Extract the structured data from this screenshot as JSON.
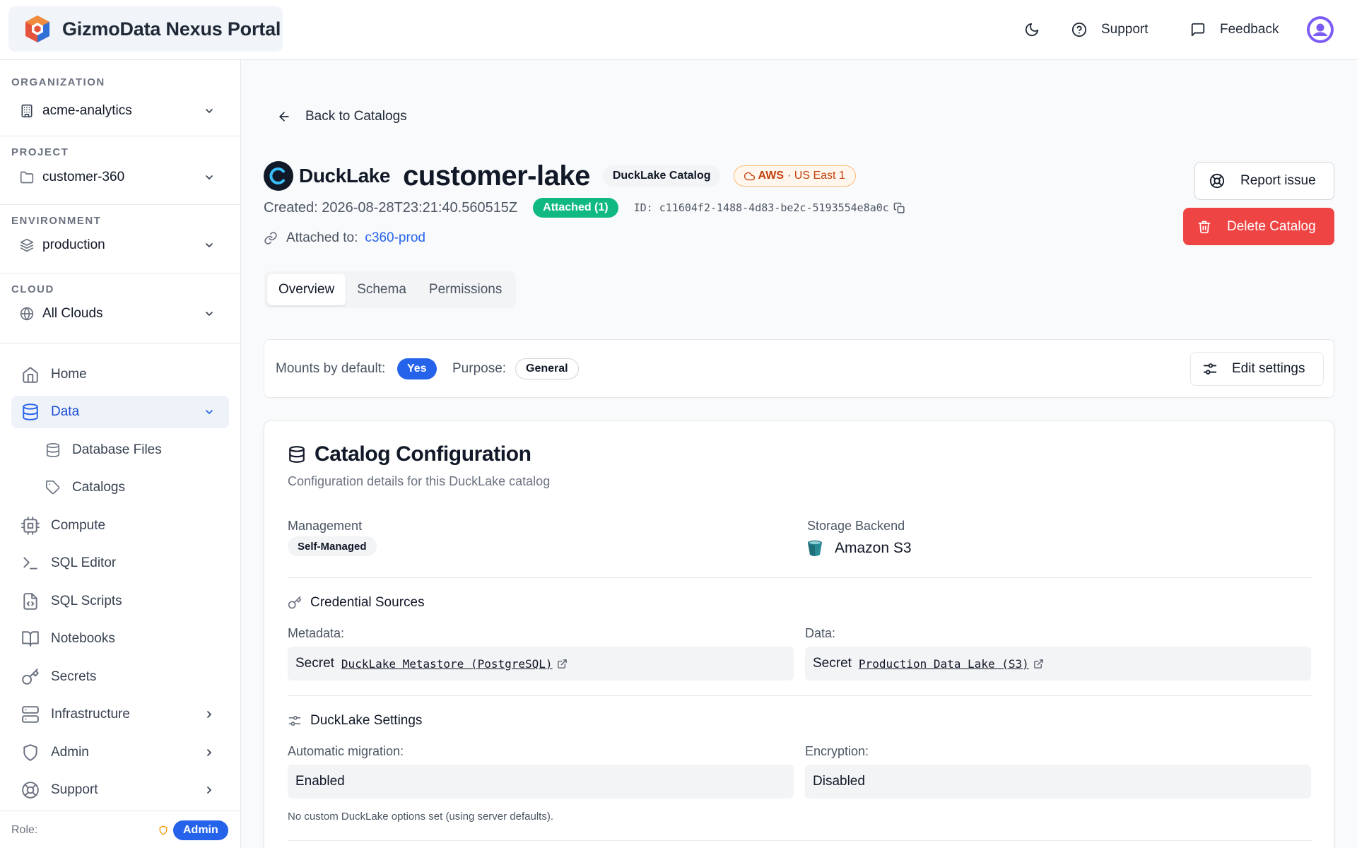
{
  "header": {
    "app_title": "GizmoData Nexus Portal",
    "support_label": "Support",
    "feedback_label": "Feedback",
    "theme_icon": "moon-icon",
    "brand_colors": {
      "accent": "#2563eb",
      "danger": "#ef4444",
      "success": "#10b981"
    }
  },
  "sidebar": {
    "organization": {
      "label": "ORGANIZATION",
      "value": "acme-analytics"
    },
    "project": {
      "label": "PROJECT",
      "value": "customer-360"
    },
    "environment": {
      "label": "ENVIRONMENT",
      "value": "production"
    },
    "cloud": {
      "label": "CLOUD",
      "value": "All Clouds"
    },
    "nav": {
      "home": "Home",
      "data": "Data",
      "database_files": "Database Files",
      "catalogs": "Catalogs",
      "compute": "Compute",
      "sql_editor": "SQL Editor",
      "sql_scripts": "SQL Scripts",
      "notebooks": "Notebooks",
      "secrets": "Secrets",
      "infrastructure": "Infrastructure",
      "admin": "Admin",
      "support": "Support"
    },
    "role": {
      "label": "Role:",
      "value": "Admin"
    }
  },
  "main": {
    "back_label": "Back to Catalogs",
    "brand_word": "DuckLake",
    "catalog_name": "customer-lake",
    "type_badge": "DuckLake Catalog",
    "cloud_badge": {
      "provider": "AWS",
      "region": "· US East 1"
    },
    "created": "Created: 2026-08-28T23:21:40.560515Z",
    "attached_badge": "Attached (1)",
    "catalog_id": "ID: c11604f2-1488-4d83-be2c-5193554e8a0c",
    "attached_to_label": "Attached to:",
    "attached_to_value": "c360-prod",
    "report_label": "Report issue",
    "delete_label": "Delete Catalog",
    "tabs": [
      {
        "label": "Overview"
      },
      {
        "label": "Schema"
      },
      {
        "label": "Permissions"
      }
    ],
    "settings_bar": {
      "mounts_label": "Mounts by default:",
      "mounts_value": "Yes",
      "purpose_label": "Purpose:",
      "purpose_value": "General",
      "edit_label": "Edit settings"
    },
    "config": {
      "title": "Catalog Configuration",
      "subtitle": "Configuration details for this DuckLake catalog",
      "management_label": "Management",
      "management_value": "Self-Managed",
      "storage_label": "Storage Backend",
      "storage_value": "Amazon S3",
      "credentials_title": "Credential Sources",
      "metadata_label": "Metadata:",
      "metadata_secret_word": "Secret",
      "metadata_secret": "DuckLake Metastore (PostgreSQL)",
      "data_label": "Data:",
      "data_secret_word": "Secret",
      "data_secret": "Production Data Lake (S3)",
      "settings_title": "DuckLake Settings",
      "migration_label": "Automatic migration:",
      "migration_value": "Enabled",
      "encryption_label": "Encryption:",
      "encryption_value": "Disabled",
      "note": "No custom DuckLake options set (using server defaults)."
    }
  }
}
